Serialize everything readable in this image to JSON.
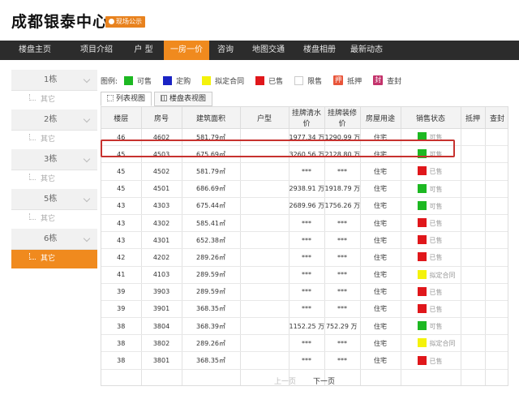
{
  "header": {
    "title": "成都银泰中心",
    "badge": "现场公示"
  },
  "nav": {
    "items": [
      {
        "label": "楼盘主页",
        "w": 86
      },
      {
        "label": "项目介绍",
        "w": 66
      },
      {
        "label": "户 型",
        "w": 50
      },
      {
        "label": "一房一价",
        "w": 56
      },
      {
        "label": "咨询",
        "w": 40
      },
      {
        "label": "地图交通",
        "w": 66
      },
      {
        "label": "楼盘相册",
        "w": 60
      },
      {
        "label": "最新动态",
        "w": 56
      }
    ],
    "active_index": 3
  },
  "sidebar": {
    "buildings": [
      {
        "label": "1栋",
        "sub": "其它"
      },
      {
        "label": "2栋",
        "sub": "其它"
      },
      {
        "label": "3栋",
        "sub": "其它"
      },
      {
        "label": "5栋",
        "sub": "其它"
      },
      {
        "label": "6栋",
        "sub": "其它"
      }
    ],
    "active_sub_index": 4
  },
  "legend": {
    "label": "图例:",
    "items": [
      {
        "label": "可售",
        "color": "#1db822",
        "kind": "fill"
      },
      {
        "label": "定购",
        "color": "#1a23c4",
        "kind": "fill"
      },
      {
        "label": "拟定合同",
        "color": "#f4f20b",
        "kind": "fill"
      },
      {
        "label": "已售",
        "color": "#e0171b",
        "kind": "fill"
      },
      {
        "label": "限售",
        "color": "#ffffff",
        "kind": "outline"
      },
      {
        "label": "抵押",
        "color": "#e8553a",
        "kind": "tag",
        "glyph": "押"
      },
      {
        "label": "查封",
        "color": "#c3336b",
        "kind": "tag",
        "glyph": "封"
      }
    ]
  },
  "tabs": [
    {
      "label": "列表视图",
      "active": true
    },
    {
      "label": "楼盘表视图",
      "active": false
    }
  ],
  "table": {
    "headers": [
      "楼层",
      "房号",
      "建筑面积",
      "户型",
      "挂牌清水价",
      "挂牌装修价",
      "房屋用途",
      "销售状态",
      "抵押",
      "查封"
    ],
    "rows": [
      {
        "floor": "46",
        "room": "4602",
        "area": "581.79㎡",
        "layout": "",
        "price_bare": "1977.34 万",
        "price_deco": "1290.99 万",
        "use": "住宅",
        "status": "可售",
        "status_color": "#1db822",
        "mortgage": "",
        "seal": ""
      },
      {
        "floor": "45",
        "room": "4503",
        "area": "675.69㎡",
        "layout": "",
        "price_bare": "3260.56 万",
        "price_deco": "2128.80 万",
        "use": "住宅",
        "status": "可售",
        "status_color": "#1db822",
        "mortgage": "",
        "seal": ""
      },
      {
        "floor": "45",
        "room": "4502",
        "area": "581.79㎡",
        "layout": "",
        "price_bare": "***",
        "price_deco": "***",
        "use": "住宅",
        "status": "已售",
        "status_color": "#e0171b",
        "mortgage": "",
        "seal": ""
      },
      {
        "floor": "45",
        "room": "4501",
        "area": "686.69㎡",
        "layout": "",
        "price_bare": "2938.91 万",
        "price_deco": "1918.79 万",
        "use": "住宅",
        "status": "可售",
        "status_color": "#1db822",
        "mortgage": "",
        "seal": ""
      },
      {
        "floor": "43",
        "room": "4303",
        "area": "675.44㎡",
        "layout": "",
        "price_bare": "2689.96 万",
        "price_deco": "1756.26 万",
        "use": "住宅",
        "status": "可售",
        "status_color": "#1db822",
        "mortgage": "",
        "seal": ""
      },
      {
        "floor": "43",
        "room": "4302",
        "area": "585.41㎡",
        "layout": "",
        "price_bare": "***",
        "price_deco": "***",
        "use": "住宅",
        "status": "已售",
        "status_color": "#e0171b",
        "mortgage": "",
        "seal": ""
      },
      {
        "floor": "43",
        "room": "4301",
        "area": "652.38㎡",
        "layout": "",
        "price_bare": "***",
        "price_deco": "***",
        "use": "住宅",
        "status": "已售",
        "status_color": "#e0171b",
        "mortgage": "",
        "seal": ""
      },
      {
        "floor": "42",
        "room": "4202",
        "area": "289.26㎡",
        "layout": "",
        "price_bare": "***",
        "price_deco": "***",
        "use": "住宅",
        "status": "已售",
        "status_color": "#e0171b",
        "mortgage": "",
        "seal": ""
      },
      {
        "floor": "41",
        "room": "4103",
        "area": "289.59㎡",
        "layout": "",
        "price_bare": "***",
        "price_deco": "***",
        "use": "住宅",
        "status": "拟定合同",
        "status_color": "#f4f20b",
        "mortgage": "",
        "seal": ""
      },
      {
        "floor": "39",
        "room": "3903",
        "area": "289.59㎡",
        "layout": "",
        "price_bare": "***",
        "price_deco": "***",
        "use": "住宅",
        "status": "已售",
        "status_color": "#e0171b",
        "mortgage": "",
        "seal": ""
      },
      {
        "floor": "39",
        "room": "3901",
        "area": "368.35㎡",
        "layout": "",
        "price_bare": "***",
        "price_deco": "***",
        "use": "住宅",
        "status": "已售",
        "status_color": "#e0171b",
        "mortgage": "",
        "seal": ""
      },
      {
        "floor": "38",
        "room": "3804",
        "area": "368.39㎡",
        "layout": "",
        "price_bare": "1152.25 万",
        "price_deco": "752.29 万",
        "use": "住宅",
        "status": "可售",
        "status_color": "#1db822",
        "mortgage": "",
        "seal": ""
      },
      {
        "floor": "38",
        "room": "3802",
        "area": "289.26㎡",
        "layout": "",
        "price_bare": "***",
        "price_deco": "***",
        "use": "住宅",
        "status": "拟定合同",
        "status_color": "#f4f20b",
        "mortgage": "",
        "seal": ""
      },
      {
        "floor": "38",
        "room": "3801",
        "area": "368.35㎡",
        "layout": "",
        "price_bare": "***",
        "price_deco": "***",
        "use": "住宅",
        "status": "已售",
        "status_color": "#e0171b",
        "mortgage": "",
        "seal": ""
      }
    ]
  },
  "pager": {
    "prev": "上一页",
    "next": "下一页"
  }
}
